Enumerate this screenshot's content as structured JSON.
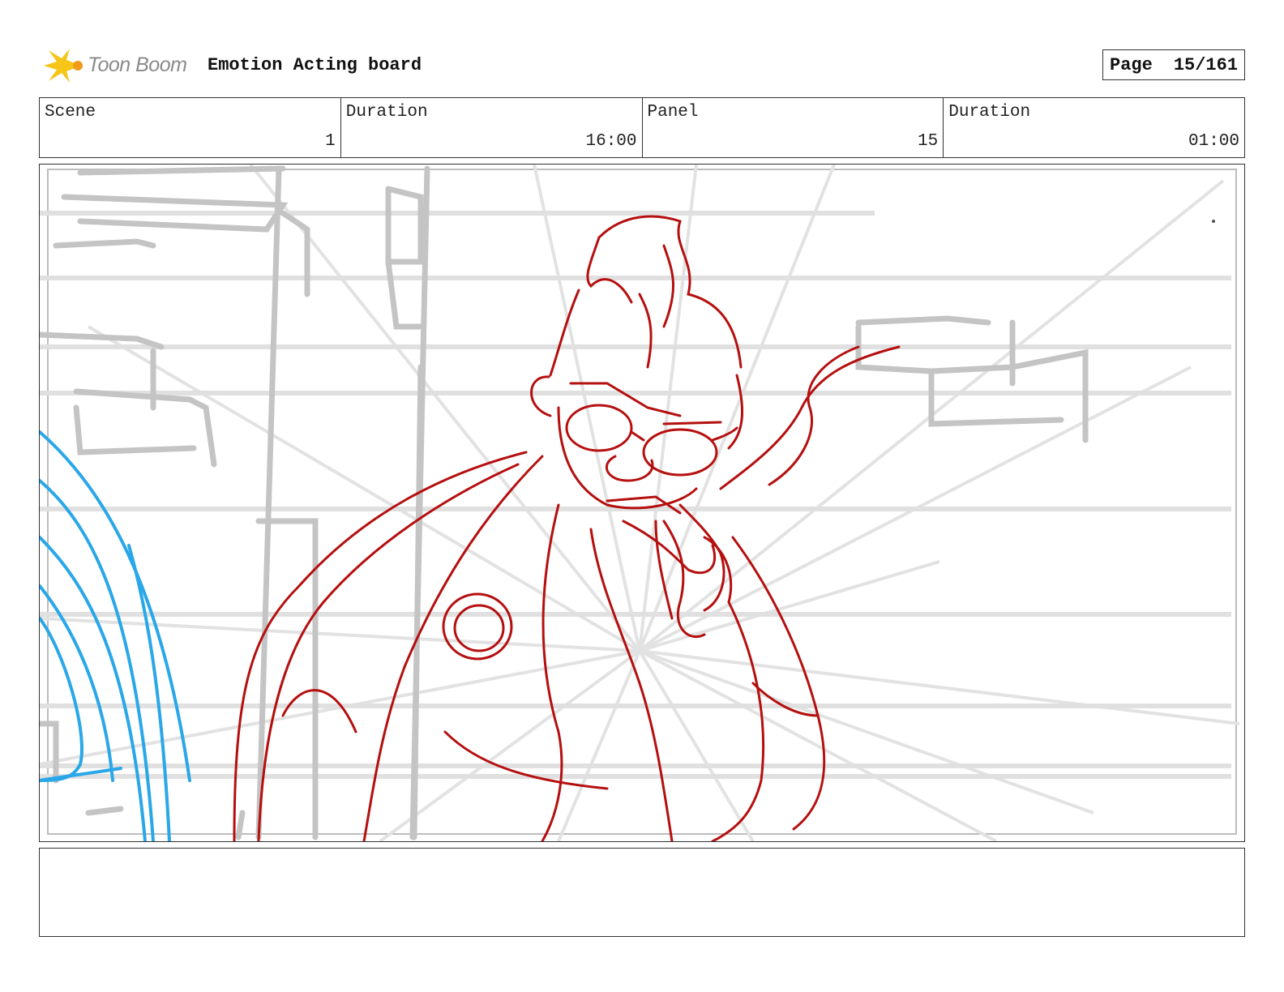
{
  "header": {
    "logo_text": "Toon Boom",
    "board_title": "Emotion Acting board",
    "page_label": "Page",
    "page_number": "15/161"
  },
  "info": {
    "scene_label": "Scene",
    "scene_value": "1",
    "scene_duration_label": "Duration",
    "scene_duration_value": "16:00",
    "panel_label": "Panel",
    "panel_value": "15",
    "panel_duration_label": "Duration",
    "panel_duration_value": "01:00"
  },
  "colors": {
    "character_lines": "#b50f0f",
    "foreground_lines": "#2aa7e8",
    "background_lines": "#c8c8c8",
    "logo_star": "#f5c518"
  },
  "notes": {
    "text": ""
  }
}
